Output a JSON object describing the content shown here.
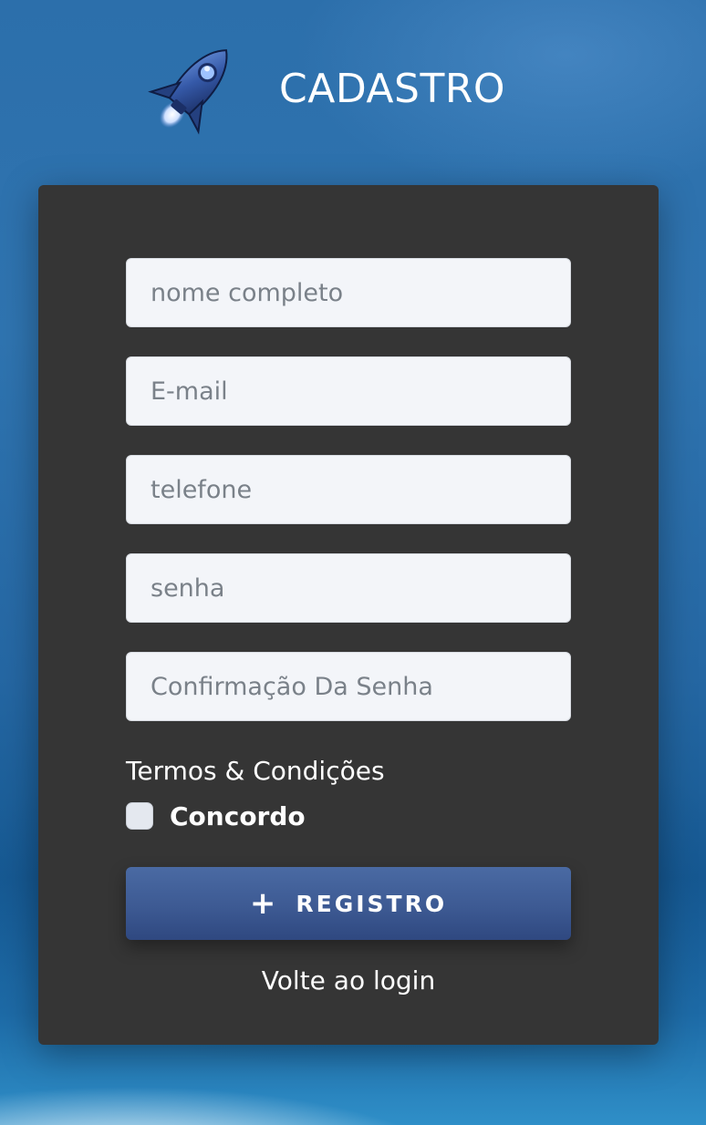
{
  "header": {
    "logo_icon": "rocket-icon",
    "title": "CADASTRO"
  },
  "form": {
    "fields": [
      {
        "placeholder": "nome completo",
        "value": ""
      },
      {
        "placeholder": "E-mail",
        "value": ""
      },
      {
        "placeholder": "telefone",
        "value": ""
      },
      {
        "placeholder": "senha",
        "value": ""
      },
      {
        "placeholder": "Confirmação Da Senha",
        "value": ""
      }
    ],
    "terms_title": "Termos & Condições",
    "agree_label": "Concordo",
    "agree_checked": false,
    "register_icon": "plus-icon",
    "register_label": "REGISTRO",
    "back_link": "Volte ao login"
  },
  "colors": {
    "card_bg": "#353535",
    "button_bg": "#3d5a93",
    "background": "#2c6fab"
  }
}
